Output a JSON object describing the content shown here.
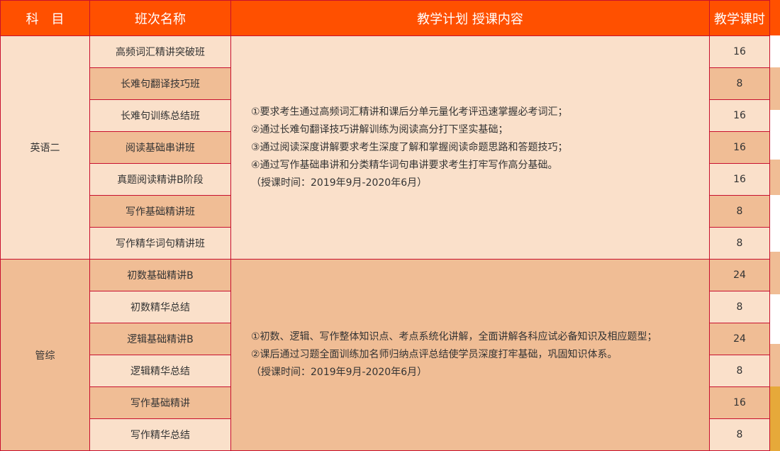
{
  "header": {
    "subject": "科　目",
    "class_name": "班次名称",
    "plan": "教学计划 授课内容",
    "hours": "教学课时"
  },
  "groups": [
    {
      "subject": "英语二",
      "rows": [
        {
          "name": "高频词汇精讲突破班",
          "hours": "16"
        },
        {
          "name": "长难句翻译技巧班",
          "hours": "8"
        },
        {
          "name": "长难句训练总结班",
          "hours": "16"
        },
        {
          "name": "阅读基础串讲班",
          "hours": "16"
        },
        {
          "name": "真题阅读精讲B阶段",
          "hours": "16"
        },
        {
          "name": "写作基础精讲班",
          "hours": "8"
        },
        {
          "name": "写作精华词句精讲班",
          "hours": "8"
        }
      ],
      "content": [
        "①要求考生通过高频词汇精讲和课后分单元量化考评迅速掌握必考词汇；",
        "②通过长难句翻译技巧讲解训练为阅读高分打下坚实基础；",
        "③通过阅读深度讲解要求考生深度了解和掌握阅读命题思路和答题技巧；",
        "④通过写作基础串讲和分类精华词句串讲要求考生打牢写作高分基础。",
        "（授课时间：2019年9月-2020年6月）"
      ]
    },
    {
      "subject": "管综",
      "rows": [
        {
          "name": "初数基础精讲B",
          "hours": "24"
        },
        {
          "name": "初数精华总结",
          "hours": "8"
        },
        {
          "name": "逻辑基础精讲B",
          "hours": "24"
        },
        {
          "name": "逻辑精华总结",
          "hours": "8"
        },
        {
          "name": "写作基础精讲",
          "hours": "16"
        },
        {
          "name": "写作精华总结",
          "hours": "8"
        }
      ],
      "content": [
        "①初数、逻辑、写作整体知识点、考点系统化讲解，全面讲解各科应试必备知识及相应题型；",
        "②课后通过习题全面训练加名师归纳点评总结使学员深度打牢基础，巩固知识体系。",
        "（授课时间：2019年9月-2020年6月）"
      ]
    }
  ],
  "colors": {
    "header_bg": "#ff5000",
    "border": "#c8102e",
    "light_row": "#fae0ca",
    "dark_row": "#f0bd95"
  }
}
